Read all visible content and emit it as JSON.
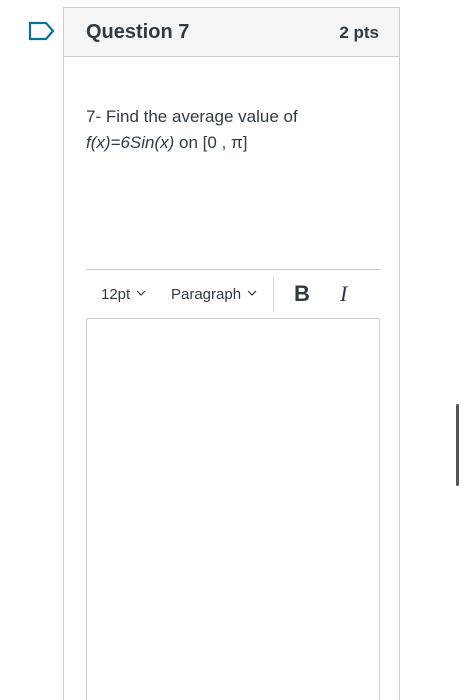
{
  "question": {
    "title": "Question 7",
    "points": "2 pts",
    "prompt_line1": "7- Find the average value of",
    "prompt_func": "f(x)=6Sin(x)",
    "prompt_interval": " on [0 , π]"
  },
  "toolbar": {
    "font_size": "12pt",
    "paragraph": "Paragraph",
    "bold": "B",
    "italic": "I"
  },
  "icons": {
    "flag": "bookmark-flag-icon",
    "chevron": "chevron-down-icon"
  },
  "colors": {
    "accent": "#0770a3",
    "text": "#2d3b45",
    "border": "#c7cdd1",
    "header_bg": "#f5f5f5"
  }
}
